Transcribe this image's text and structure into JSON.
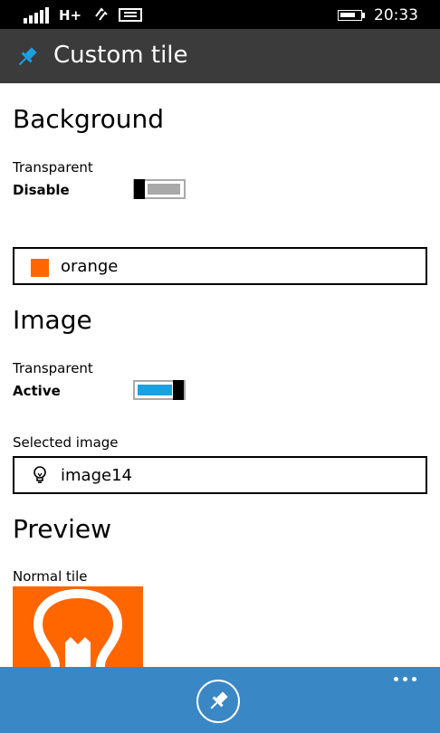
{
  "status_bar": {
    "network": "H+",
    "time": "20:33",
    "battery_level": 0.8
  },
  "header": {
    "title": "Custom tile",
    "icon": "pin-icon"
  },
  "background_section": {
    "title": "Background",
    "transparent_label": "Transparent",
    "transparent_state": "Disable",
    "transparent_on": false,
    "color_value": "orange",
    "color_hex": "#ff6600"
  },
  "image_section": {
    "title": "Image",
    "transparent_label": "Transparent",
    "transparent_state": "Active",
    "transparent_on": true,
    "selected_label": "Selected image",
    "selected_value": "image14",
    "selected_icon": "lightbulb-icon"
  },
  "preview_section": {
    "title": "Preview",
    "normal_tile_label": "Normal tile",
    "tile_color": "#ff6600",
    "tile_icon": "lightbulb-icon"
  },
  "app_bar": {
    "primary_button_icon": "pin-icon",
    "more_icon": "ellipsis-icon",
    "color": "#3a87c6"
  },
  "colors": {
    "accent": "#1ba1e2",
    "toggle_off": "#a9a9a9"
  }
}
